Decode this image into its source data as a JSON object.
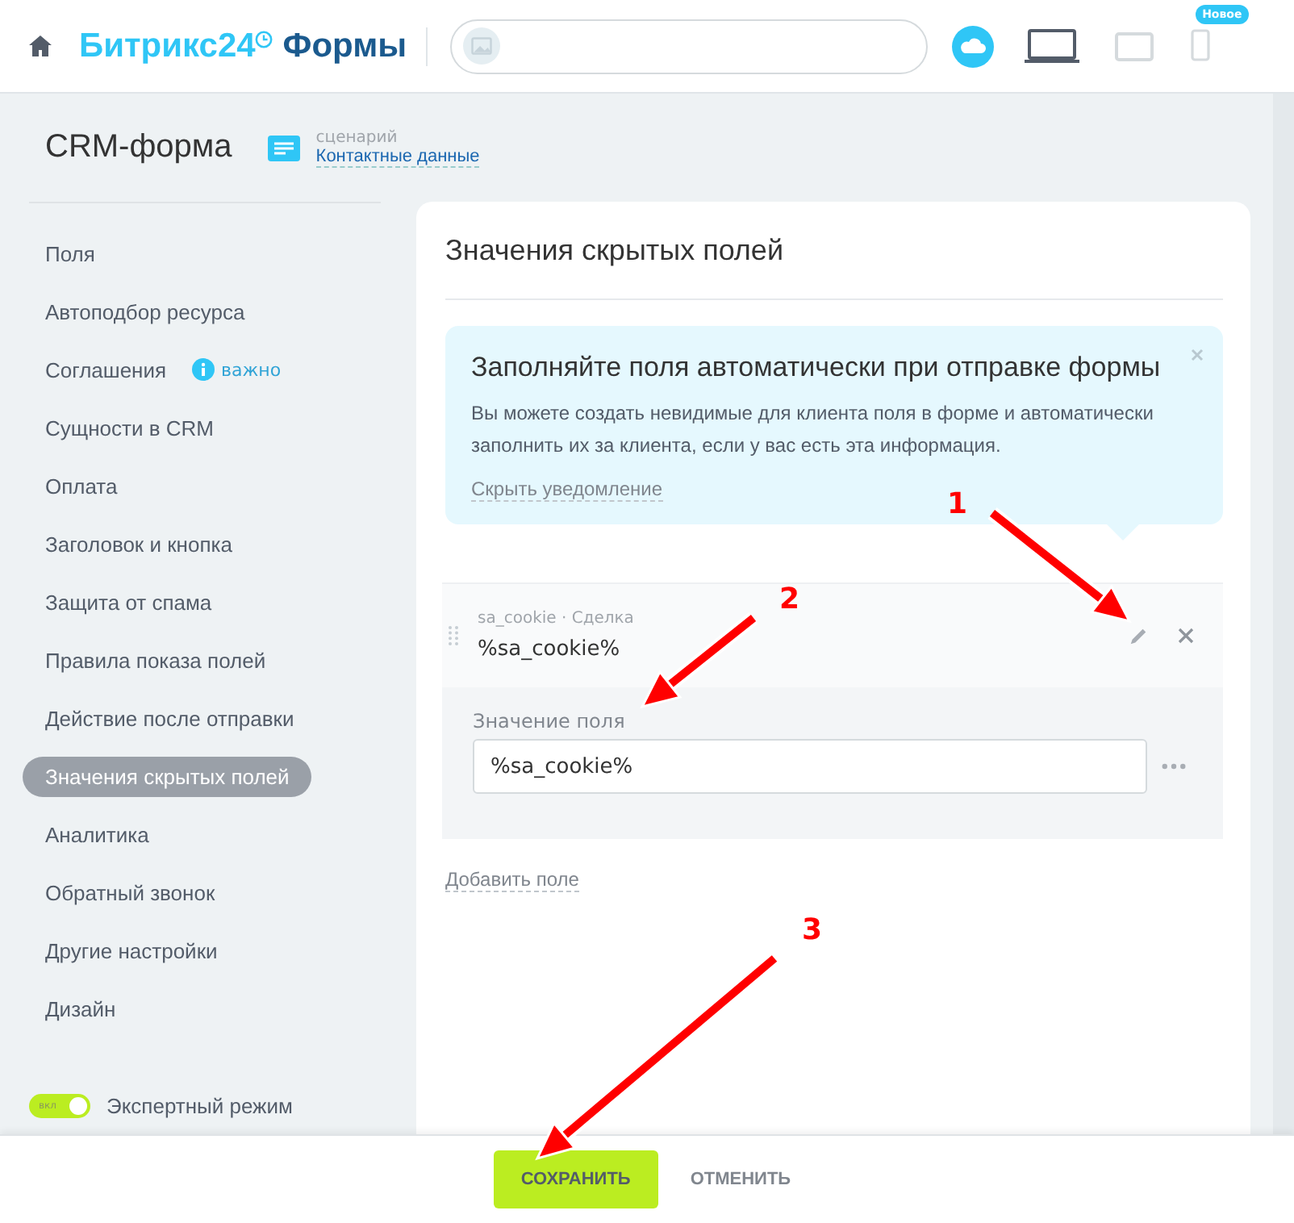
{
  "header": {
    "brand": "Битрикс24",
    "product": "Формы",
    "devices": [
      {
        "kind": "cloud",
        "selected": true
      },
      {
        "kind": "laptop",
        "selected": true
      },
      {
        "kind": "tablet",
        "selected": false
      },
      {
        "kind": "phone",
        "selected": false,
        "badge": "Новое"
      }
    ]
  },
  "form": {
    "title": "CRM-форма",
    "scenario_label": "сценарий",
    "scenario_link": "Контактные данные"
  },
  "sidebar": {
    "items": [
      {
        "label": "Поля",
        "selected": false
      },
      {
        "label": "Автоподбор ресурса",
        "selected": false
      },
      {
        "label": "Соглашения",
        "selected": false,
        "hint": "важно"
      },
      {
        "label": "Сущности в CRM",
        "selected": false
      },
      {
        "label": "Оплата",
        "selected": false
      },
      {
        "label": "Заголовок и кнопка",
        "selected": false
      },
      {
        "label": "Защита от спама",
        "selected": false
      },
      {
        "label": "Правила показа полей",
        "selected": false
      },
      {
        "label": "Действие после отправки",
        "selected": false
      },
      {
        "label": "Значения скрытых полей",
        "selected": true
      },
      {
        "label": "Аналитика",
        "selected": false
      },
      {
        "label": "Обратный звонок",
        "selected": false
      },
      {
        "label": "Другие настройки",
        "selected": false
      },
      {
        "label": "Дизайн",
        "selected": false
      }
    ],
    "expert_mode": {
      "on": true,
      "switch_text": "вкл",
      "label": "Экспертный режим"
    }
  },
  "panel": {
    "title": "Значения скрытых полей",
    "notice": {
      "title": "Заполняйте поля автоматически при отправке формы",
      "text": "Вы можете создать невидимые для клиента поля в форме и автоматически заполнить их за клиента, если у вас есть эта информация.",
      "hide_link": "Скрыть уведомление"
    },
    "fields": [
      {
        "meta": "sa_cookie · Сделка",
        "name": "%sa_cookie%",
        "value_label": "Значение поля",
        "value": "%sa_cookie%"
      }
    ],
    "add_link": "Добавить поле"
  },
  "footer": {
    "buttons": [
      {
        "label": "СОХРАНИТЬ",
        "kind": "primary"
      },
      {
        "label": "ОТМЕНИТЬ",
        "kind": "link"
      }
    ]
  },
  "annotations": [
    {
      "label": "1"
    },
    {
      "label": "2"
    },
    {
      "label": "3"
    }
  ]
}
